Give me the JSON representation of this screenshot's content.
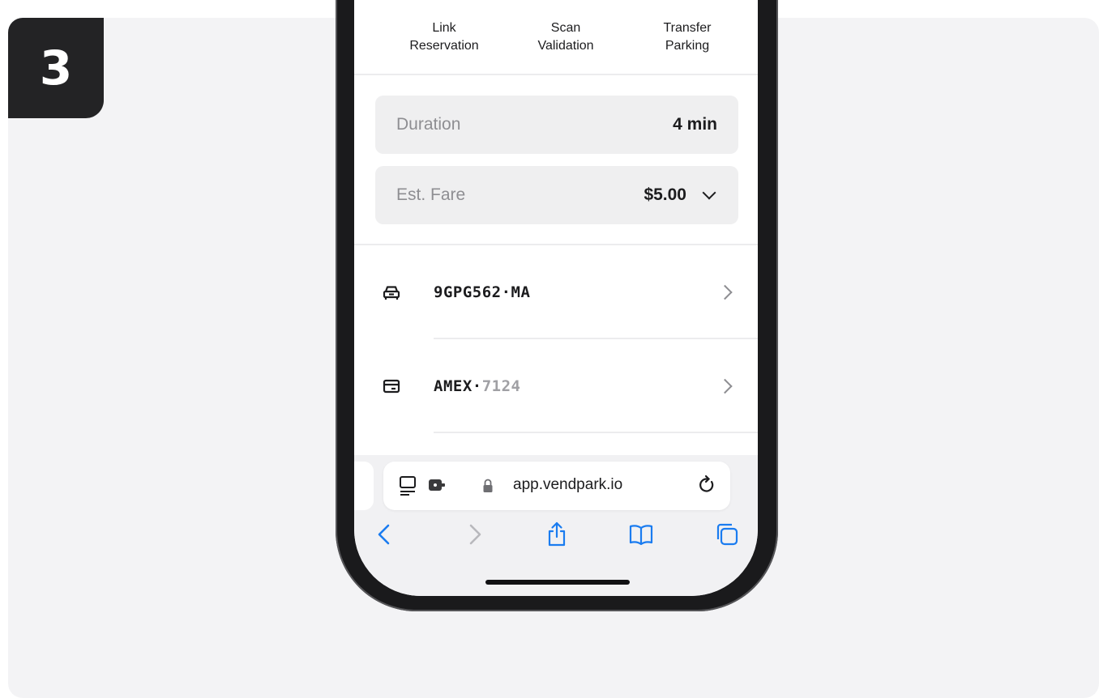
{
  "step": {
    "number": "3"
  },
  "top_actions": [
    {
      "line1": "Link",
      "line2": "Reservation"
    },
    {
      "line1": "Scan",
      "line2": "Validation"
    },
    {
      "line1": "Transfer",
      "line2": "Parking"
    }
  ],
  "duration": {
    "label": "Duration",
    "value": "4 min"
  },
  "fare": {
    "label": "Est. Fare",
    "value": "$5.00"
  },
  "vehicle": {
    "plate": "9GPG562",
    "separator": "·",
    "state": "MA"
  },
  "payment": {
    "brand": "AMEX",
    "separator": "·",
    "last4": "7124"
  },
  "browser": {
    "url": "app.vendpark.io"
  },
  "colors": {
    "card_bg": "#f3f3f5",
    "badge_bg": "#232325",
    "ios_blue": "#1a7cf0",
    "muted": "#8e8e92"
  },
  "icons": {
    "vehicle": "car-icon",
    "payment": "credit-card-icon",
    "lock": "lock-icon",
    "reader": "reader-mode-icon",
    "extension": "extension-icon",
    "reload": "reload-icon",
    "back": "chevron-left-icon",
    "forward": "chevron-right-icon",
    "share": "share-icon",
    "bookmarks": "book-icon",
    "tabs": "tabs-icon"
  }
}
